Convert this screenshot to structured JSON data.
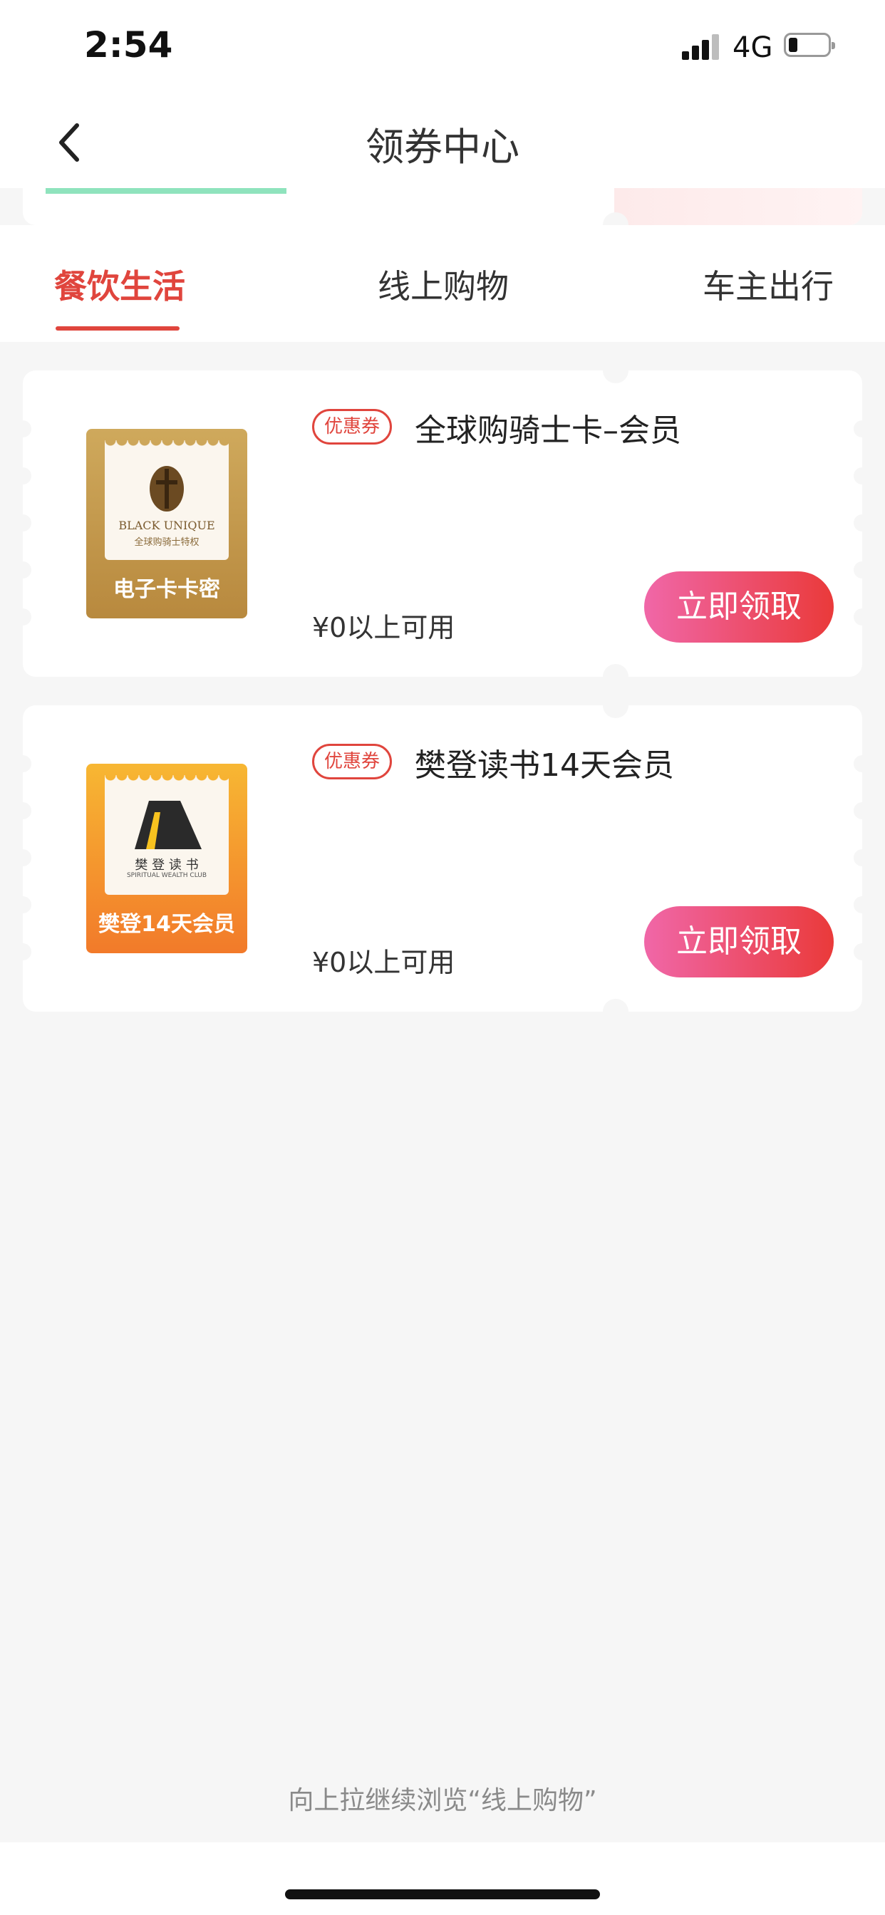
{
  "status_bar": {
    "time": "2:54",
    "network": "4G"
  },
  "nav": {
    "title": "领券中心"
  },
  "tabs": [
    {
      "label": "餐饮生活",
      "active": true
    },
    {
      "label": "线上购物",
      "active": false
    },
    {
      "label": "车主出行",
      "active": false
    }
  ],
  "coupons": [
    {
      "tag": "优惠券",
      "title": "全球购骑士卡–会员",
      "condition": "¥0以上可用",
      "button": "立即领取",
      "thumb_label": "电子卡卡密",
      "thumb_brand": "BLACK UNIQUE",
      "thumb_sub": "全球购骑士特权"
    },
    {
      "tag": "优惠券",
      "title": "樊登读书14天会员",
      "condition": "¥0以上可用",
      "button": "立即领取",
      "thumb_label": "樊登14天会员",
      "thumb_brand": "樊 登 读 书",
      "thumb_sub": "SPIRITUAL WEALTH CLUB"
    }
  ],
  "footer": {
    "hint": "向上拉继续浏览“线上购物”"
  },
  "colors": {
    "accent": "#e0453d",
    "button_start": "#f067a8",
    "button_end": "#ea3a3a"
  }
}
